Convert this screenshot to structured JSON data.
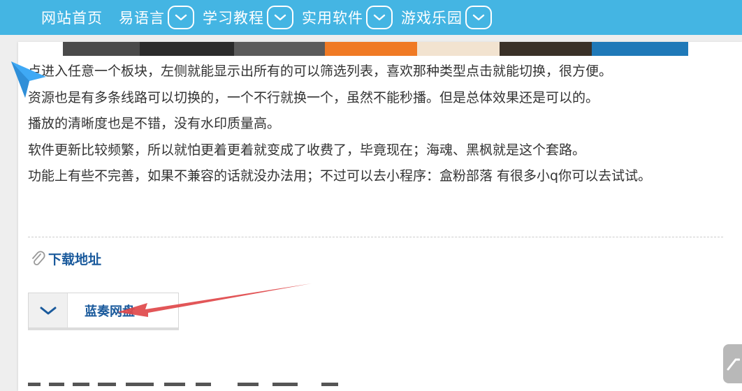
{
  "nav": {
    "items": [
      {
        "label": "网站首页"
      },
      {
        "label": "易语言"
      },
      {
        "label": "学习教程"
      },
      {
        "label": "实用软件"
      },
      {
        "label": "游戏乐园"
      }
    ],
    "chevron_icon": "chevron-down-icon"
  },
  "article": {
    "paragraphs": [
      "点进入任意一个板块，左侧就能显示出所有的可以筛选列表，喜欢那种类型点击就能切换，很方便。",
      "资源也是有多条线路可以切换的，一个不行就换一个，虽然不能秒播。但是总体效果还是可以的。",
      "播放的清晰度也是不错，没有水印质量高。",
      "软件更新比较频繁，所以就怕更着更着就变成了收费了，毕竟现在；海魂、黑枫就是这个套路。",
      "功能上有些不完善，如果不兼容的话就没办法用；不过可以去小程序：盒粉部落 有很多小q你可以去试试。"
    ]
  },
  "download": {
    "heading": "下载地址",
    "heading_icon": "paperclip-icon",
    "button_label": "蓝奏网盘",
    "button_icon": "chevron-down-icon"
  },
  "colors": {
    "topbar": "#44b5e3",
    "link_blue": "#1a5a9c",
    "annotation_red": "#e0484a",
    "cursor_blue": "#3fa9f5"
  },
  "overlay_icons": [
    "cursor-icon",
    "scroll-top-icon",
    "red-arrow-annotation"
  ]
}
